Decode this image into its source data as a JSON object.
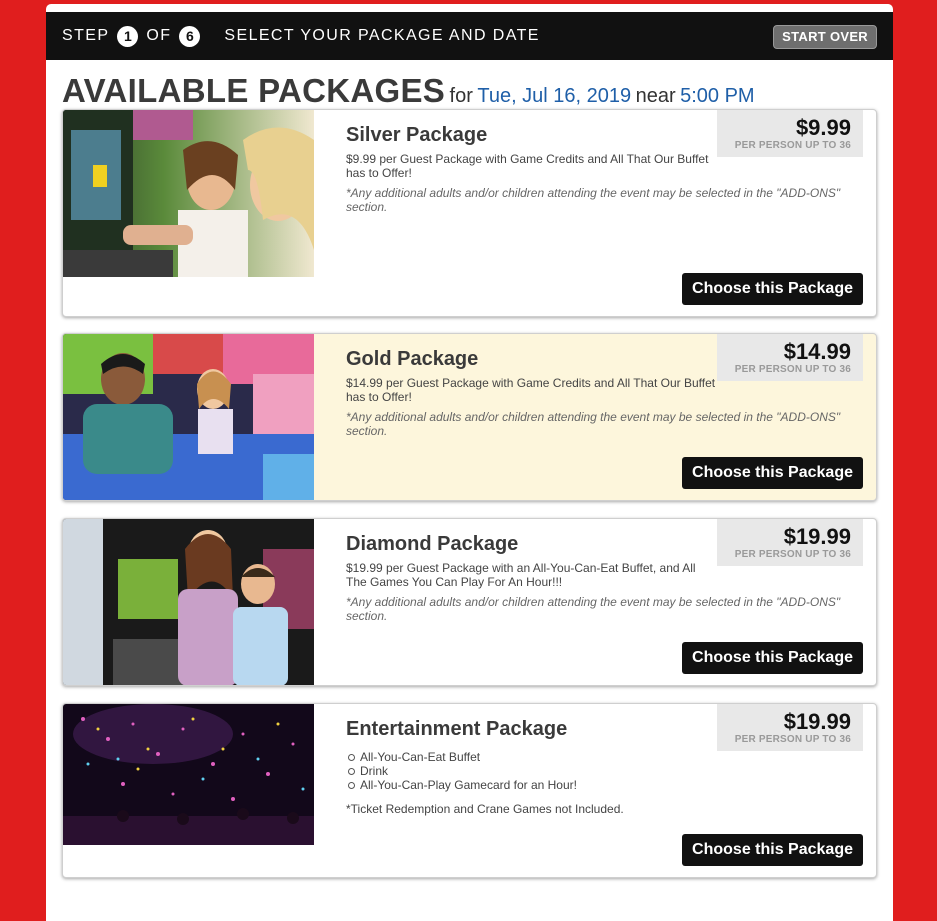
{
  "stepbar": {
    "step_label": "STEP",
    "step_current": "1",
    "of_label": "OF",
    "step_total": "6",
    "title": "SELECT YOUR PACKAGE AND DATE",
    "start_over": "START OVER"
  },
  "heading": {
    "title": "AVAILABLE PACKAGES",
    "for_label": "for",
    "date": "Tue, Jul 16, 2019",
    "near_label": "near",
    "time": "5:00 PM"
  },
  "packages": [
    {
      "name": "Silver Package",
      "price": "$9.99",
      "per": "PER PERSON UP TO 36",
      "description": "$9.99 per Guest Package with Game Credits and All That Our Buffet has to Offer!",
      "note": "*Any additional adults and/or children attending the event may be selected in the \"ADD-ONS\" section.",
      "button": "Choose this Package",
      "photo": "girl-and-woman-playing-arcade-photo"
    },
    {
      "name": "Gold Package",
      "price": "$14.99",
      "per": "PER PERSON UP TO 36",
      "description": "$14.99 per Guest Package with Game Credits and All That Our Buffet has to Offer!",
      "note": "*Any additional adults and/or children attending the event may be selected in the \"ADD-ONS\" section.",
      "button": "Choose this Package",
      "photo": "boy-and-girl-racing-game-photo"
    },
    {
      "name": "Diamond Package",
      "price": "$19.99",
      "per": "PER PERSON UP TO 36",
      "description": "$19.99 per Guest Package with an All-You-Can-Eat Buffet, and All The Games You Can Play For An Hour!!!",
      "note": "*Any additional adults and/or children attending the event may be selected in the \"ADD-ONS\" section.",
      "button": "Choose this Package",
      "photo": "kids-at-arcade-photo"
    },
    {
      "name": "Entertainment Package",
      "price": "$19.99",
      "per": "PER PERSON UP TO 36",
      "bullets": [
        "All-You-Can-Eat Buffet",
        "Drink",
        "All-You-Can-Play Gamecard for an Hour!"
      ],
      "ticket_note": "*Ticket Redemption and Crane Games not Included.",
      "button": "Choose this Package",
      "photo": "confetti-crowd-photo"
    }
  ],
  "colors": {
    "page_background": "#e01e1e",
    "accent_blue": "#1f5fa8",
    "highlight_card": "#fdf6dc",
    "button_black": "#111111"
  }
}
